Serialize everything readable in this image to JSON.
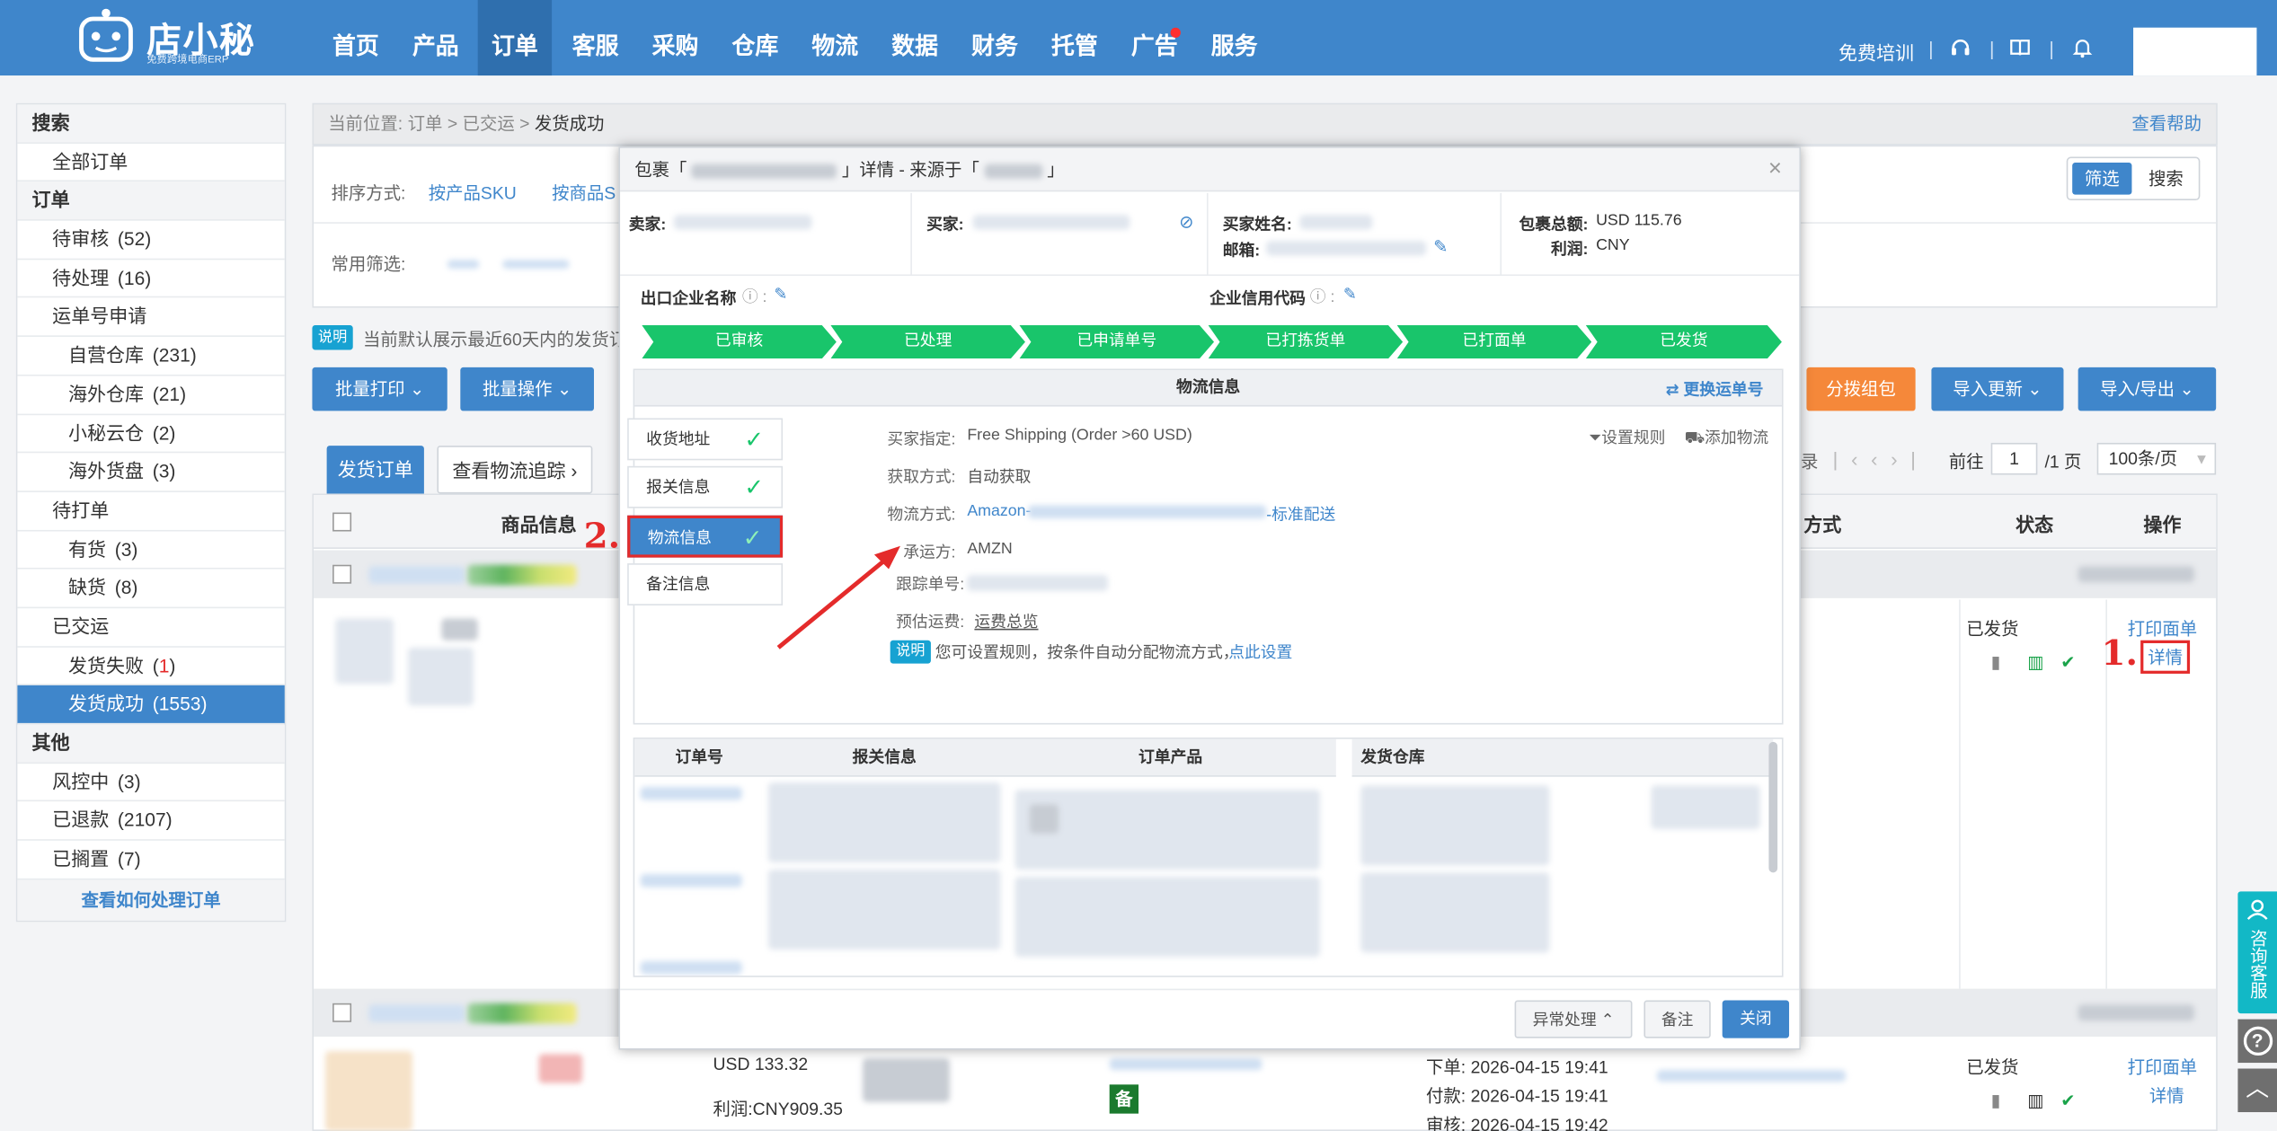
{
  "app": {
    "logo_name": "店小秘",
    "logo_sub": "免费跨境电商ERP"
  },
  "nav": {
    "items": [
      "首页",
      "产品",
      "订单",
      "客服",
      "采购",
      "仓库",
      "物流",
      "数据",
      "财务",
      "托管",
      "广告",
      "服务"
    ],
    "active": "订单",
    "right_training": "免费培训",
    "icons": [
      "headset-icon",
      "book-icon",
      "bell-icon"
    ]
  },
  "sidebar": {
    "search_head": "搜索",
    "all_orders": "全部订单",
    "order_head": "订单",
    "pending_review": "待审核",
    "pending_review_count": "(52)",
    "pending_process": "待处理",
    "pending_process_count": "(16)",
    "waybill_apply": "运单号申请",
    "own_warehouse": "自营仓库",
    "own_warehouse_count": "(231)",
    "overseas_warehouse": "海外仓库",
    "overseas_warehouse_count": "(21)",
    "cloud_warehouse": "小秘云仓",
    "cloud_warehouse_count": "(2)",
    "overseas_stock": "海外货盘",
    "overseas_stock_count": "(3)",
    "pending_print": "待打单",
    "in_stock": "有货",
    "in_stock_count": "(3)",
    "out_stock": "缺货",
    "out_stock_count": "(8)",
    "shipped": "已交运",
    "ship_fail": "发货失败",
    "ship_fail_count_pre": "(",
    "ship_fail_count": "1",
    "ship_fail_count_post": ")",
    "ship_success": "发货成功",
    "ship_success_count": "(1553)",
    "other_head": "其他",
    "risk": "风控中",
    "risk_count": "(3)",
    "refunded": "已退款",
    "refunded_count": "(2107)",
    "shelved": "已搁置",
    "shelved_count": "(7)",
    "how_link": "查看如何处理订单"
  },
  "main": {
    "breadcrumb_prefix": "当前位置:",
    "breadcrumb_1": "订单",
    "breadcrumb_2": "已交运",
    "breadcrumb_3": "发货成功",
    "help": "查看帮助",
    "sort_label": "排序方式:",
    "sort_sku": "按产品SKU",
    "sort_goods": "按商品S",
    "common_filter": "常用筛选:",
    "filter_btn": "筛选",
    "search_btn": "搜索",
    "notice_badge": "说明",
    "notice_text": "当前默认展示最近60天内的发货订",
    "batch_print": "批量打印",
    "batch_op": "批量操作",
    "split_pack": "分拨组包",
    "import_update": "导入更新",
    "import_export": "导入/导出",
    "tab_ship_orders": "发货订单",
    "tab_tracking": "查看物流追踪",
    "pager_prev_text": "录",
    "pager_goto": "前往",
    "pager_page": "1",
    "pager_total": "/1 页",
    "pager_size": "100条/页",
    "col_product": "商品信息",
    "col_method": "方式",
    "col_status": "状态",
    "col_action": "操作",
    "row1_status": "已发货",
    "row1_print": "打印面单",
    "row1_detail": "详情",
    "row2_amount": "USD 133.32",
    "row2_profit": "利润:CNY909.35",
    "row2_bei": "备",
    "row2_order_time": "下单:  2026-04-15 19:41",
    "row2_pay_time": "付款:  2026-04-15 19:41",
    "row2_review_time": "审核:  2026-04-15 19:42",
    "row2_status": "已发货",
    "row2_print": "打印面单",
    "row2_detail": "详情"
  },
  "modal": {
    "title_a": "包裹「",
    "title_b": "」详情 - 来源于「",
    "title_c": "」",
    "seller_label": "卖家:",
    "buyer_label": "买家:",
    "buyer_name_label": "买家姓名:",
    "email_label": "邮箱:",
    "total_label": "包裹总额:",
    "total_value": "USD 115.76",
    "profit_label": "利润:",
    "profit_value": "CNY",
    "export_company": "出口企业名称",
    "credit_code": "企业信用代码",
    "steps": [
      "已审核",
      "已处理",
      "已申请单号",
      "已打拣货单",
      "已打面单",
      "已发货"
    ],
    "logistics_header": "物流信息",
    "change_waybill": "更换运单号",
    "tabs": [
      "收货地址",
      "报关信息",
      "物流信息",
      "备注信息"
    ],
    "buyer_specified_label": "买家指定:",
    "buyer_specified_value": "Free Shipping (Order >60 USD)",
    "get_method_label": "获取方式:",
    "get_method_value": "自动获取",
    "ship_method_label": "物流方式:",
    "ship_method_prefix": "Amazon-",
    "ship_method_suffix": "-标准配送",
    "carrier_label": "承运方:",
    "carrier_value": "AMZN",
    "tracking_label": "跟踪单号:",
    "est_fee_label": "预估运费:",
    "est_fee_link": "运费总览",
    "set_rule": "设置规则",
    "add_logistics": "添加物流",
    "tip_badge": "说明",
    "tip_text": "您可设置规则，按条件自动分配物流方式，",
    "tip_link": "点此设置",
    "col_order_no": "订单号",
    "col_customs": "报关信息",
    "col_order_product": "订单产品",
    "col_warehouse": "发货仓库",
    "btn_exception": "异常处理",
    "btn_note": "备注",
    "btn_close": "关闭",
    "close_x": "×"
  },
  "annotations": {
    "mark1": "1.",
    "mark2": "2."
  },
  "float": {
    "consult": "咨询客服",
    "help_q": "?",
    "top": "︿"
  },
  "colors": {
    "primary": "#3f86cb",
    "success": "#19c56b",
    "orange": "#f5883a",
    "annotation": "#e42b2b"
  }
}
